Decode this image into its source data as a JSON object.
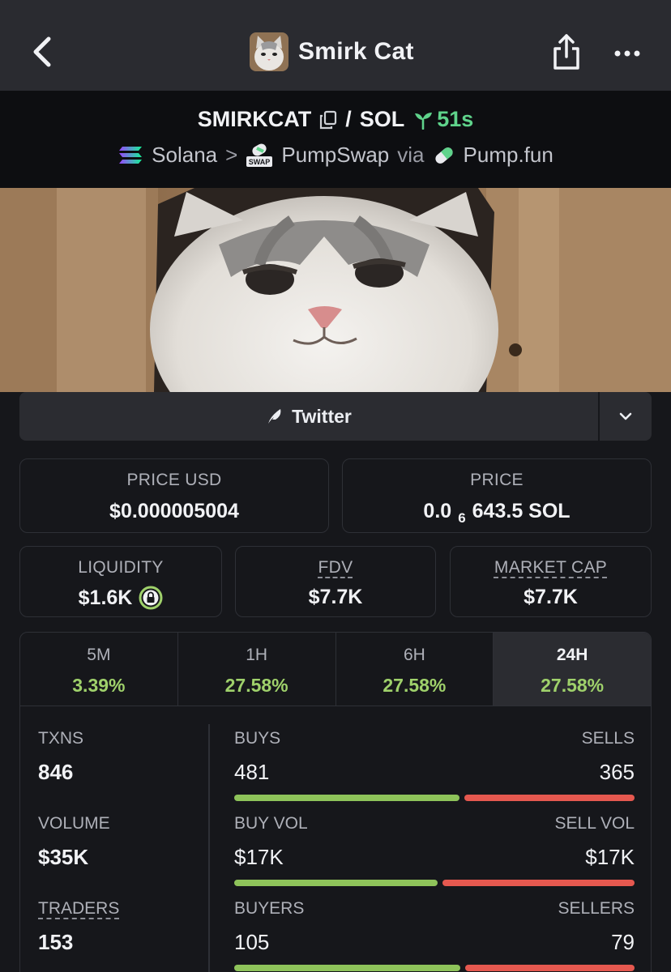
{
  "header": {
    "title": "Smirk Cat",
    "back_icon": "chevron-left-icon",
    "share_icon": "share-icon",
    "more_icon": "more-dots-icon"
  },
  "pair": {
    "base": "SMIRKCAT",
    "separator": "/",
    "quote": "SOL",
    "age": "51s",
    "chain": "Solana",
    "chevron": ">",
    "dex": "PumpSwap",
    "via": "via",
    "launchpad": "Pump.fun",
    "dex_badge": "SWAP"
  },
  "social": {
    "twitter_label": "Twitter"
  },
  "metrics": {
    "price_usd_label": "PRICE USD",
    "price_usd": "$0.000005004",
    "price_label": "PRICE",
    "price_prefix": "0.0",
    "price_sub": "6",
    "price_suffix": "643.5 SOL",
    "liquidity_label": "LIQUIDITY",
    "liquidity": "$1.6K",
    "fdv_label": "FDV",
    "fdv": "$7.7K",
    "mcap_label": "MARKET CAP",
    "mcap": "$7.7K"
  },
  "tabs": [
    {
      "label": "5M",
      "value": "3.39%"
    },
    {
      "label": "1H",
      "value": "27.58%"
    },
    {
      "label": "6H",
      "value": "27.58%"
    },
    {
      "label": "24H",
      "value": "27.58%"
    }
  ],
  "stats": {
    "txns_label": "TXNS",
    "txns": "846",
    "buys_label": "BUYS",
    "buys": "481",
    "sells_label": "SELLS",
    "sells": "365",
    "buys_fraction": 0.569,
    "volume_label": "VOLUME",
    "volume": "$35K",
    "buy_vol_label": "BUY VOL",
    "buy_vol": "$17K",
    "sell_vol_label": "SELL VOL",
    "sell_vol": "$17K",
    "buy_vol_fraction": 0.515,
    "traders_label": "TRADERS",
    "traders": "153",
    "buyers_label": "BUYERS",
    "buyers": "105",
    "sellers_label": "SELLERS",
    "sellers": "79",
    "buyers_fraction": 0.571
  },
  "colors": {
    "positive": "#9fd16b",
    "buy_bar": "#8ec35a",
    "sell_bar": "#e5584f",
    "age": "#5fd38b"
  }
}
